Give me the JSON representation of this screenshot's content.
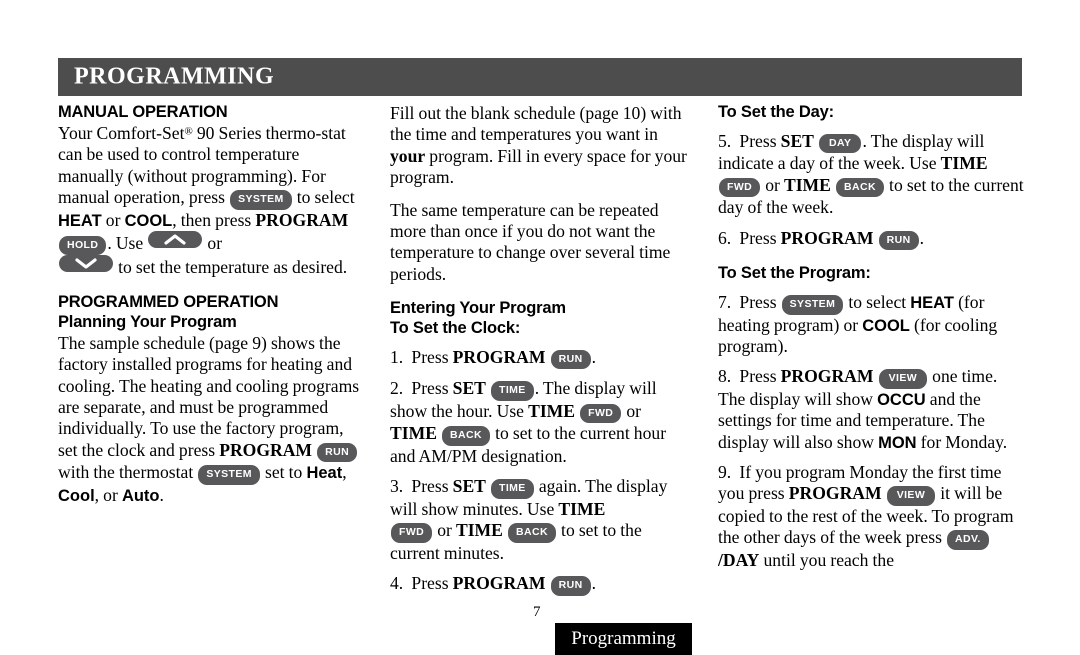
{
  "header": {
    "title": "PROGRAMMING",
    "bar_color": "#4d4d4d",
    "text_color": "#ffffff"
  },
  "theme": {
    "pill_color": "#58585a",
    "pill_text_color": "#ffffff",
    "page_background": "#ffffff",
    "body_text_color": "#000000",
    "footer_tab_color": "#000000"
  },
  "columns": {
    "left": {
      "heading_manual": "MANUAL OPERATION",
      "p1_a": "Your Comfort-Set",
      "p1_reg": "®",
      "p1_b": " 90 Series thermo-stat can be used to control temperature manually (without programming). For manual operation, press ",
      "p1_btn_system": "SYSTEM",
      "p1_c": " to select ",
      "p1_heat": "HEAT",
      "p1_d": " or ",
      "p1_cool": "COOL",
      "p1_e": ", then press ",
      "p1_program": "PROGRAM",
      "p1_btn_hold": "HOLD",
      "p1_f": ". Use ",
      "p1_btn_up": "up-arrow",
      "p1_g": " or ",
      "p1_btn_down": "down-arrow",
      "p1_h": " to set the temperature as desired.",
      "heading_programmed": "PROGRAMMED OPERATION",
      "heading_planning": "Planning Your Program",
      "p2_a": "The sample schedule (page 9) shows the factory installed programs for heating and cooling. The heating and cooling programs are separate, and must be programmed individually. To use the factory program, set the clock and press ",
      "p2_program": "PROGRAM",
      "p2_btn_run": "RUN",
      "p2_b": " with the thermostat ",
      "p2_btn_system": "SYSTEM",
      "p2_c": " set to ",
      "p2_heat": "Heat",
      "p2_d": ", ",
      "p2_cool": "Cool",
      "p2_e": ", or ",
      "p2_auto": "Auto",
      "p2_f": "."
    },
    "middle": {
      "p1_a": "Fill out the blank schedule (page 10) with the time and temperatures you want in ",
      "p1_your": "your",
      "p1_b": " program. Fill in every space for your program.",
      "p2": "The same temperature can be repeated more than once if you do not want the temperature to change over several time periods.",
      "heading_entering": "Entering Your Program",
      "heading_clock": "To Set the Clock:",
      "step1_num": "1.",
      "step1_a": "Press ",
      "step1_program": "PROGRAM",
      "step1_btn_run": "RUN",
      "step1_b": ".",
      "step2_num": "2.",
      "step2_a": "Press ",
      "step2_set": "SET",
      "step2_btn_time": "TIME",
      "step2_b": ". The display will show the hour. Use ",
      "step2_time1": "TIME",
      "step2_btn_fwd": "FWD",
      "step2_c": " or ",
      "step2_time2": "TIME",
      "step2_btn_back": "BACK",
      "step2_d": " to set to the current hour and AM/PM designation.",
      "step3_num": "3.",
      "step3_a": "Press ",
      "step3_set": "SET",
      "step3_btn_time": "TIME",
      "step3_b": " again. The display will show minutes. Use ",
      "step3_time1": "TIME",
      "step3_btn_fwd": "FWD",
      "step3_c": " or ",
      "step3_time2": "TIME",
      "step3_btn_back": "BACK",
      "step3_d": " to set to the current minutes.",
      "step4_num": "4.",
      "step4_a": "Press ",
      "step4_program": "PROGRAM",
      "step4_btn_run": "RUN",
      "step4_b": "."
    },
    "right": {
      "heading_day": "To Set the Day:",
      "step5_num": "5.",
      "step5_a": "Press ",
      "step5_set": "SET",
      "step5_btn_day": "DAY",
      "step5_b": ". The display will indicate a day of the week. Use ",
      "step5_time1": "TIME",
      "step5_btn_fwd": "FWD",
      "step5_c": " or ",
      "step5_time2": "TIME",
      "step5_btn_back": "BACK",
      "step5_d": " to set to the current day of the week.",
      "step6_num": "6.",
      "step6_a": "Press ",
      "step6_program": "PROGRAM",
      "step6_btn_run": "RUN",
      "step6_b": ".",
      "heading_program": "To Set the Program:",
      "step7_num": "7.",
      "step7_a": "Press ",
      "step7_btn_system": "SYSTEM",
      "step7_b": " to select ",
      "step7_heat": "HEAT",
      "step7_c": " (for heating program) or ",
      "step7_cool": "COOL",
      "step7_d": " (for cooling program).",
      "step8_num": "8.",
      "step8_a": "Press ",
      "step8_program": "PROGRAM",
      "step8_btn_view": "VIEW",
      "step8_b": " one time. The display will show ",
      "step8_occu": "OCCU",
      "step8_c": " and the settings for time and temperature. The display will also show ",
      "step8_mon": "MON",
      "step8_d": " for Monday.",
      "step9_num": "9.",
      "step9_a": "If you program Monday the first time you press ",
      "step9_program": "PROGRAM",
      "step9_btn_view": "VIEW",
      "step9_b": " it will be copied to the rest of the week. To program the other days of the week press ",
      "step9_btn_adv": "ADV.",
      "step9_day": "/DAY",
      "step9_c": " until you reach the"
    }
  },
  "footer": {
    "page_number": "7",
    "tab_label": "Programming"
  }
}
